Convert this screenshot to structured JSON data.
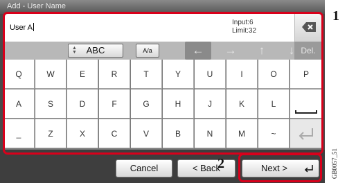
{
  "window": {
    "title": "Add - User Name"
  },
  "input": {
    "value": "User A",
    "info_line1": "Input:6",
    "info_line2": "Limit:32"
  },
  "toolbar": {
    "mode_label": "ABC",
    "case_label": "A/a",
    "arrow_left": "←",
    "arrow_right": "→",
    "arrow_up": "↑",
    "arrow_down": "↓",
    "del_label": "Del."
  },
  "keyboard": {
    "rows": [
      [
        "Q",
        "W",
        "E",
        "R",
        "T",
        "Y",
        "U",
        "I",
        "O",
        "P"
      ],
      [
        "A",
        "S",
        "D",
        "F",
        "G",
        "H",
        "J",
        "K",
        "L",
        ""
      ],
      [
        "_",
        "Z",
        "X",
        "C",
        "V",
        "B",
        "N",
        "M",
        "~",
        ""
      ]
    ]
  },
  "footer": {
    "cancel_label": "Cancel",
    "back_label": "< Back",
    "next_label": "Next >"
  },
  "annotations": {
    "callout_1": "1",
    "callout_2": "2",
    "figure_code": "GB0057_51"
  },
  "colors": {
    "callout": "#d9001b",
    "background": "#4a4a4a"
  }
}
